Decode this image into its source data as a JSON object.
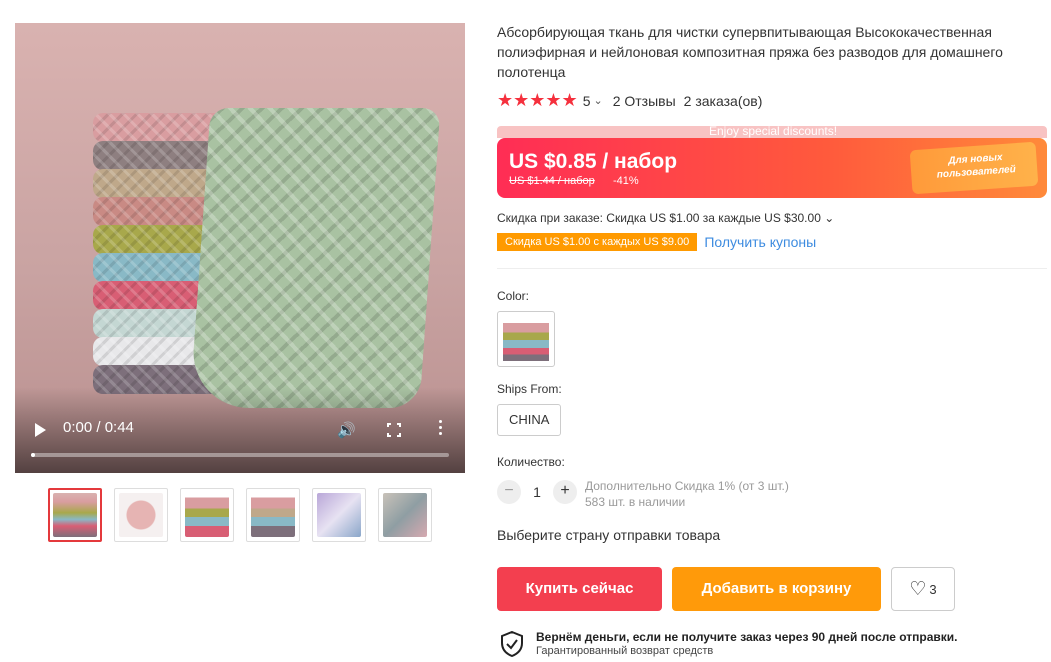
{
  "video": {
    "time_display": "0:00 / 0:44",
    "play_icon": "play-icon",
    "volume_icon": "volume-icon",
    "fullscreen_icon": "fullscreen-icon",
    "more_icon": "more-vertical-icon",
    "progress": 0.0
  },
  "thumbnails": [
    {
      "name": "thumb-1",
      "active": true
    },
    {
      "name": "thumb-2",
      "active": false
    },
    {
      "name": "thumb-3",
      "active": false
    },
    {
      "name": "thumb-4",
      "active": false
    },
    {
      "name": "thumb-5",
      "active": false
    },
    {
      "name": "thumb-6",
      "active": false
    }
  ],
  "product": {
    "title": "Абсорбирующая ткань для чистки супервпитывающая Высококачественная полиэфирная и нейлоновая композитная пряжа без разводов для домашнего полотенца",
    "stars": "★★★★★",
    "rating": "5",
    "reviews": "2 Отзывы",
    "orders": "2 заказа(ов)"
  },
  "promo": {
    "banner_top": "Enjoy special discounts!",
    "price": "US $0.85 / набор",
    "old_price": "US $1.44 / набор",
    "discount": "-41%",
    "new_user": "Для новых пользователей"
  },
  "discounts": {
    "order_discount": "Скидка при заказе: Скидка US $1.00 за каждые US $30.00",
    "coupon_tag": "Скидка US $1.00 с каждых US $9.00",
    "get_coupons": "Получить купоны"
  },
  "options": {
    "color_label": "Color:",
    "ships_from_label": "Ships From:",
    "ships_from_value": "CHINA",
    "quantity_label": "Количество:",
    "quantity_value": "1",
    "quantity_discount": "Дополнительно Скидка 1% (от 3 шт.)",
    "stock": "583 шт. в наличии",
    "choose_country": "Выберите страну отправки товара"
  },
  "actions": {
    "buy_now": "Купить сейчас",
    "add_to_cart": "Добавить в корзину",
    "wishlist_count": "3"
  },
  "guarantee": {
    "title": "Вернём деньги, если не получите заказ через 90 дней после отправки.",
    "subtitle": "Гарантированный возврат средств"
  },
  "colors": {
    "accent_red": "#f33f4f",
    "accent_orange": "#ff9a0a",
    "link_blue": "#3e8ce0",
    "star_red": "#f5303d"
  }
}
